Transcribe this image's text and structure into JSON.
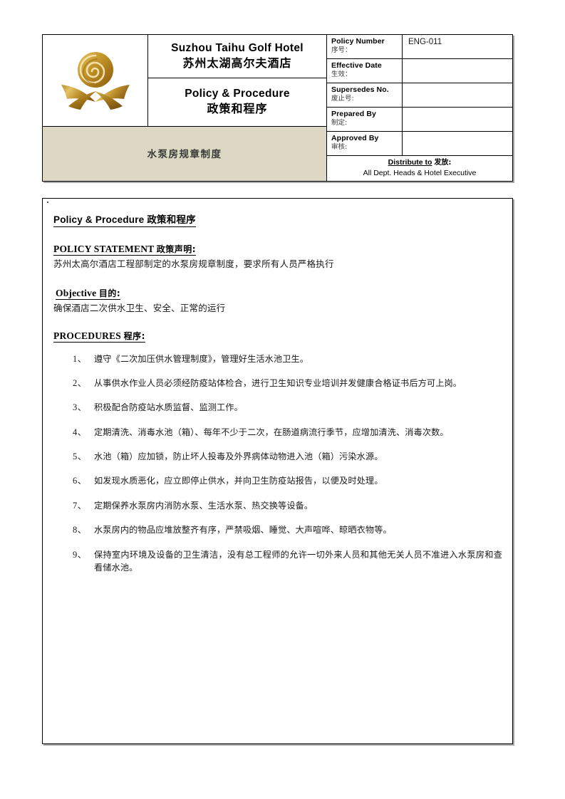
{
  "header": {
    "logo_icon": "hotel-gold-emblem-logo",
    "hotel_name_en": "Suzhou Taihu Golf Hotel",
    "hotel_name_cn": "苏州太湖高尔夫酒店",
    "doc_type_en": "Policy & Procedure",
    "doc_type_cn": "政策和程序",
    "subject_cn": "水泵房规章制度",
    "subject_band_color": "#dcd8c4",
    "meta": [
      {
        "label_en": "Policy Number",
        "label_cn": "序号：",
        "value": "ENG-011"
      },
      {
        "label_en": "Effective Date",
        "label_cn": "生效：",
        "value": ""
      },
      {
        "label_en": "Supersedes No.",
        "label_cn": "废止号:",
        "value": ""
      },
      {
        "label_en": "Prepared By",
        "label_cn": "制定:",
        "value": ""
      },
      {
        "label_en": "Approved By",
        "label_cn": "审核:",
        "value": ""
      }
    ],
    "distribute_label_en": "Distribute to",
    "distribute_label_cn": "发放:",
    "distribute_value": "All Dept. Heads & Hotel Executive"
  },
  "body": {
    "heading_en": "Policy & Procedure",
    "heading_cn": "政策和程序",
    "policy_statement": {
      "heading_en": "POLICY STATEMENT",
      "heading_cn": "政策声明:",
      "text": "苏州太高尔酒店工程部制定的水泵房规章制度，要求所有人员严格执行"
    },
    "objective": {
      "heading_en": "Objective",
      "heading_cn": "目的:",
      "text": "确保酒店二次供水卫生、安全、正常的运行"
    },
    "procedures": {
      "heading_en": "PROCEDURES",
      "heading_cn": "程序:",
      "items": [
        {
          "num": "1、",
          "text": "遵守《二次加压供水管理制度》，管理好生活水池卫生。"
        },
        {
          "num": "2、",
          "text": "从事供水作业人员必须经防疫站体检合，进行卫生知识专业培训并发健康合格证书后方可上岗。"
        },
        {
          "num": "3、",
          "text": "积极配合防疫站水质监督、监测工作。"
        },
        {
          "num": "4、",
          "text": "定期清洗、消毒水池（箱）、每年不少于二次，在肠道病流行季节，应增加清洗、消毒次数。"
        },
        {
          "num": "5、",
          "text": "水池（箱）应加锁，防止坏人投毒及外界病体动物进入池（箱）污染水源。"
        },
        {
          "num": "6、",
          "text": "如发现水质恶化，应立即停止供水，并向卫生防疫站报告，以便及时处理。"
        },
        {
          "num": "7、",
          "text": "定期保养水泵房内消防水泵、生活水泵、热交换等设备。"
        },
        {
          "num": "8、",
          "text": "水泵房内的物品应堆放整齐有序，严禁吸烟、睡觉、大声喧哗、晾晒衣物等。"
        },
        {
          "num": "9、",
          "text": "保持室内环境及设备的卫生清洁，没有总工程师的允许一切外来人员和其他无关人员不准进入水泵房和查看储水池。"
        }
      ]
    }
  }
}
